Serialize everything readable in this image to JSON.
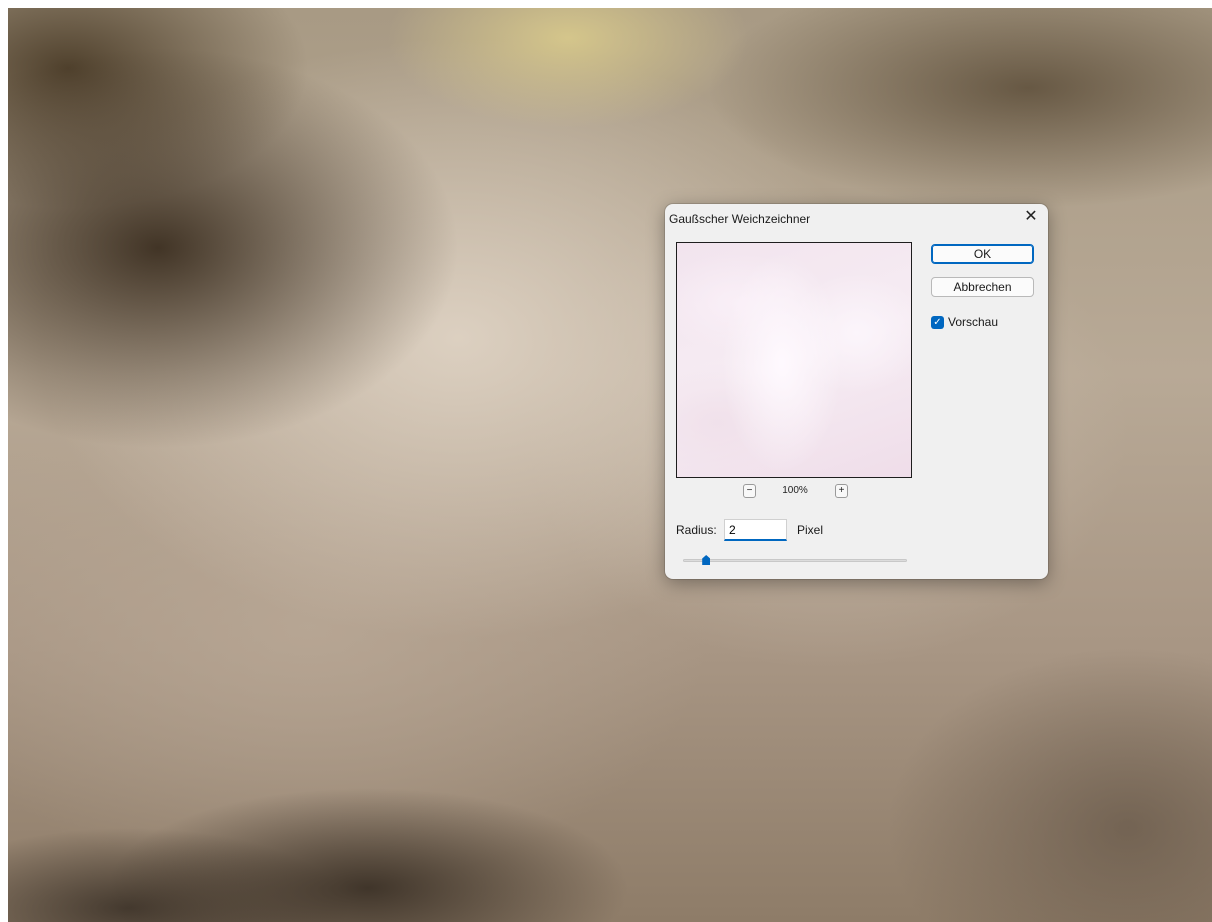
{
  "dialog": {
    "title": "Gaußscher Weichzeichner",
    "close_glyph": "✕",
    "zoom": {
      "minus_glyph": "−",
      "plus_glyph": "+",
      "value": "100%"
    },
    "ok_label": "OK",
    "cancel_label": "Abbrechen",
    "preview_checkbox": {
      "label": "Vorschau",
      "checked": true,
      "check_glyph": "✓"
    },
    "radius": {
      "label": "Radius:",
      "value": "2",
      "unit": "Pixel",
      "slider_fraction": 0.1
    }
  },
  "colors": {
    "accent": "#0067c0",
    "dialog_bg": "#f0f0f0"
  },
  "icons": [
    "close-icon",
    "zoom-out-icon",
    "zoom-in-icon",
    "checkmark-icon"
  ]
}
